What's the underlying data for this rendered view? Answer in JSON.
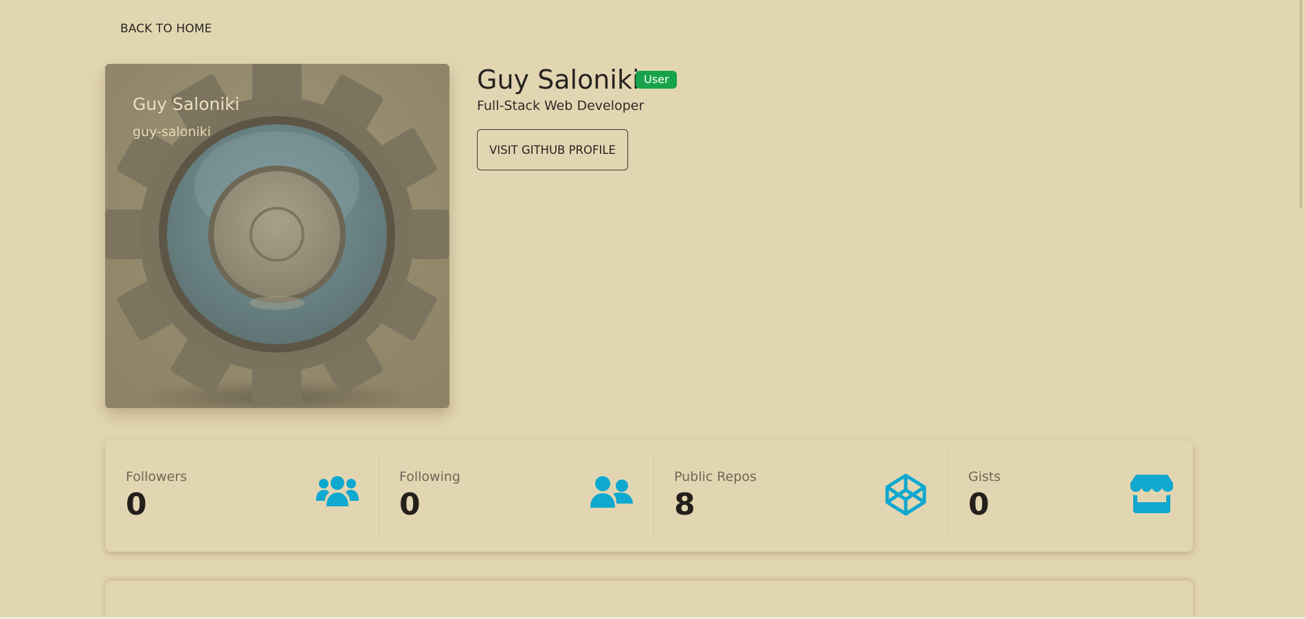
{
  "nav": {
    "back_label": "BACK TO HOME"
  },
  "avatar": {
    "name": "Guy Saloniki",
    "login": "guy-saloniki",
    "icon": "gear-avatar"
  },
  "profile": {
    "name": "Guy Saloniki",
    "badge": "User",
    "bio": "Full-Stack Web Developer",
    "github_button": "VISIT GITHUB PROFILE"
  },
  "stats": [
    {
      "label": "Followers",
      "value": "0",
      "icon": "users-icon"
    },
    {
      "label": "Following",
      "value": "0",
      "icon": "user-friends-icon"
    },
    {
      "label": "Public Repos",
      "value": "8",
      "icon": "codepen-icon"
    },
    {
      "label": "Gists",
      "value": "0",
      "icon": "store-icon"
    }
  ],
  "colors": {
    "background": "#e2d6b2",
    "accent_icon": "#0fa8cf",
    "badge": "#18a34a"
  }
}
